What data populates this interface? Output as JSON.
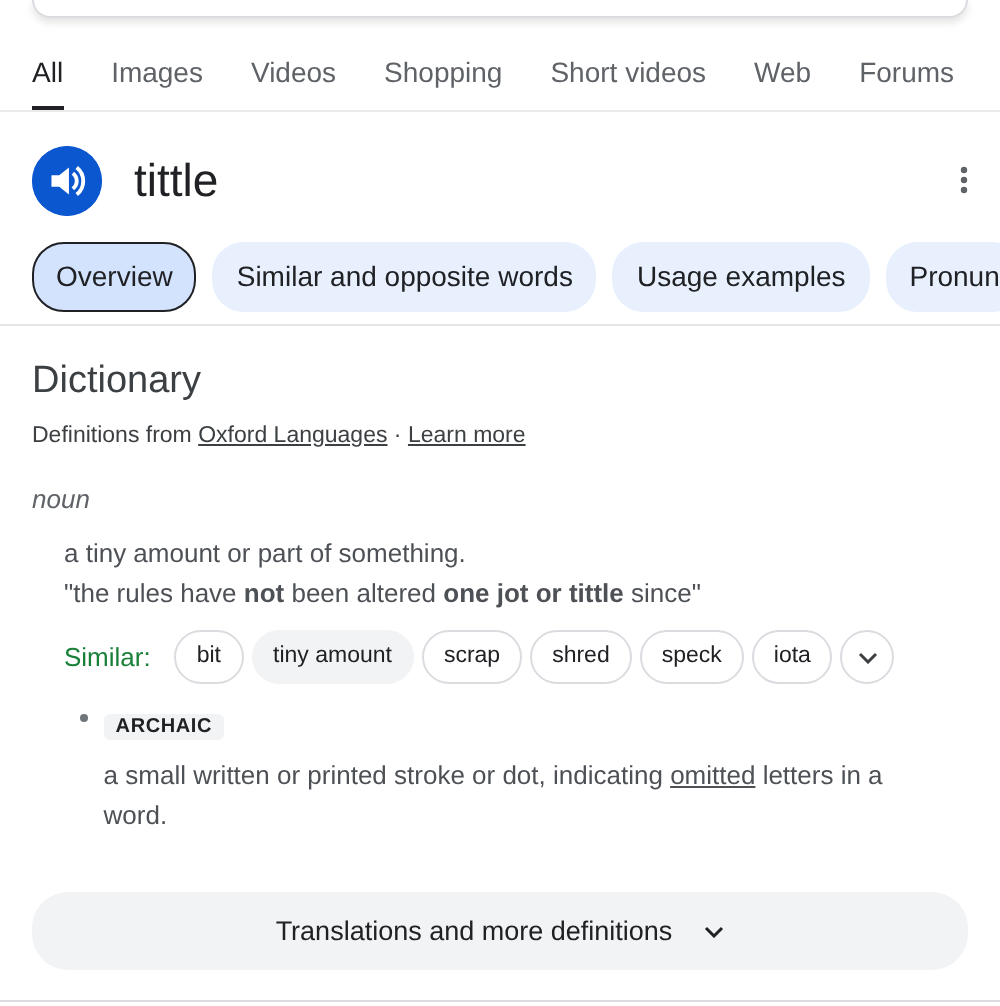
{
  "nav_tabs": [
    {
      "label": "All",
      "selected": true
    },
    {
      "label": "Images",
      "selected": false
    },
    {
      "label": "Videos",
      "selected": false
    },
    {
      "label": "Shopping",
      "selected": false
    },
    {
      "label": "Short videos",
      "selected": false
    },
    {
      "label": "Web",
      "selected": false
    },
    {
      "label": "Forums",
      "selected": false
    }
  ],
  "word": "tittle",
  "section_chips": [
    {
      "label": "Overview",
      "selected": true
    },
    {
      "label": "Similar and opposite words",
      "selected": false
    },
    {
      "label": "Usage examples",
      "selected": false
    },
    {
      "label": "Pronun",
      "selected": false
    }
  ],
  "dictionary": {
    "title": "Dictionary",
    "source_prefix": "Definitions from",
    "source_link": "Oxford Languages",
    "separator": "·",
    "learn_more": "Learn more",
    "part_of_speech": "noun",
    "senses": [
      {
        "definition": "a tiny amount or part of something.",
        "example": "\"the rules have **not** been altered **one jot or tittle** since\"",
        "similar_label": "Similar:",
        "similar": [
          {
            "label": "bit",
            "selected": false
          },
          {
            "label": "tiny amount",
            "selected": true
          },
          {
            "label": "scrap",
            "selected": false
          },
          {
            "label": "shred",
            "selected": false
          },
          {
            "label": "speck",
            "selected": false
          },
          {
            "label": "iota",
            "selected": false
          }
        ]
      },
      {
        "label": "ARCHAIC",
        "definition": "a small written or printed stroke or dot, indicating",
        "linked_word": "omitted",
        "definition_end": "letters in a word."
      }
    ]
  },
  "more_button": "Translations and more definitions"
}
